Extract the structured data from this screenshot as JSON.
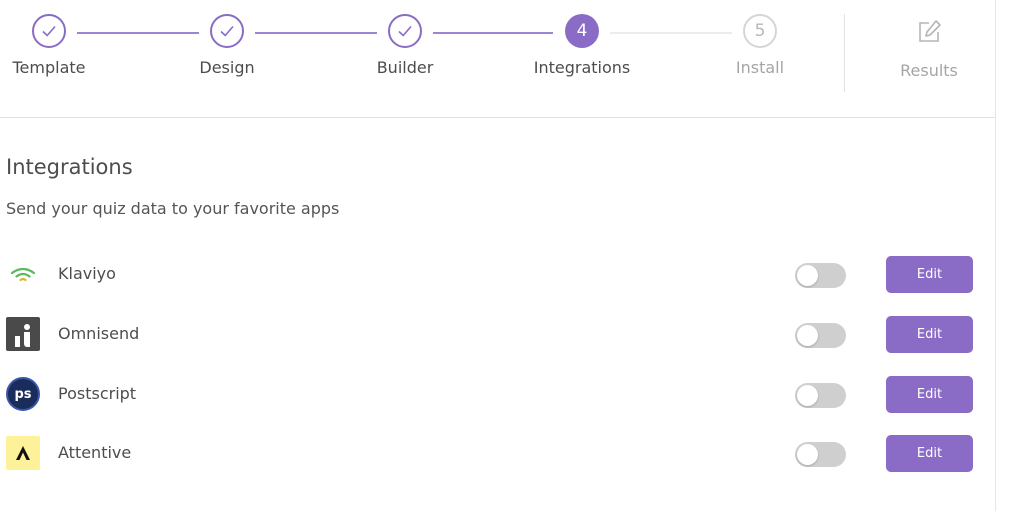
{
  "stepper": {
    "steps": [
      {
        "label": "Template",
        "state": "done",
        "number": ""
      },
      {
        "label": "Design",
        "state": "done",
        "number": ""
      },
      {
        "label": "Builder",
        "state": "done",
        "number": ""
      },
      {
        "label": "Integrations",
        "state": "active",
        "number": "4"
      },
      {
        "label": "Install",
        "state": "todo",
        "number": "5"
      }
    ],
    "results_label": "Results"
  },
  "integrations": {
    "title": "Integrations",
    "subtitle": "Send your quiz data to your favorite apps",
    "items": [
      {
        "name": "Klaviyo",
        "icon": "klaviyo-logo-icon",
        "enabled": false,
        "edit_label": "Edit"
      },
      {
        "name": "Omnisend",
        "icon": "omnisend-logo-icon",
        "enabled": false,
        "edit_label": "Edit"
      },
      {
        "name": "Postscript",
        "icon": "postscript-logo-icon",
        "logo_text": "ps",
        "enabled": false,
        "edit_label": "Edit"
      },
      {
        "name": "Attentive",
        "icon": "attentive-logo-icon",
        "enabled": false,
        "edit_label": "Edit"
      }
    ]
  },
  "colors": {
    "accent": "#8a6cc6",
    "toggle_off": "#cfcfcf",
    "klaviyo_green": "#5cb85c",
    "attentive_yellow": "#fdf29a"
  }
}
